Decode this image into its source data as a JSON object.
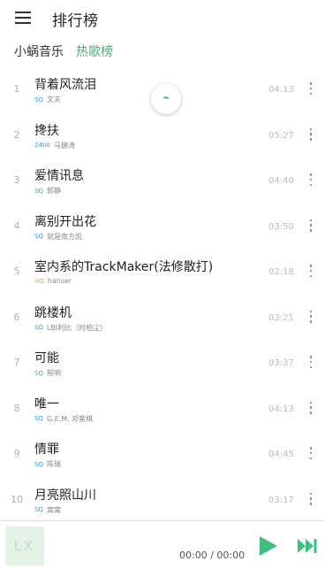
{
  "header": {
    "title": "排行榜",
    "menu_icon": "hamburger-menu-icon"
  },
  "breadcrumb": {
    "source": "小蜗音乐",
    "active": "热歌榜",
    "active_color": "#4caf7a"
  },
  "songs": [
    {
      "rank": "1",
      "title": "背着风流泪",
      "quality": "SQ",
      "artist": "文夫",
      "duration": "04:13"
    },
    {
      "rank": "2",
      "title": "搀扶",
      "quality": "24bit",
      "artist": "马健涛",
      "duration": "05:27"
    },
    {
      "rank": "3",
      "title": "爱情讯息",
      "quality": "SQ",
      "artist": "郭静",
      "duration": "04:40"
    },
    {
      "rank": "4",
      "title": "离别开出花",
      "quality": "SQ",
      "artist": "就是南方凯",
      "duration": "03:50"
    },
    {
      "rank": "5",
      "title": "室内系的TrackMaker(法修散打)",
      "quality": "HQ",
      "artist": "hanser",
      "duration": "02:18"
    },
    {
      "rank": "6",
      "title": "跳楼机",
      "quality": "SQ",
      "artist": "LBI利比（时柏尘）",
      "duration": "03:21"
    },
    {
      "rank": "7",
      "title": "可能",
      "quality": "SQ",
      "artist": "程响",
      "duration": "03:37"
    },
    {
      "rank": "8",
      "title": "唯一",
      "quality": "SQ",
      "artist": "G.E.M. 邓紫棋",
      "duration": "04:13"
    },
    {
      "rank": "9",
      "title": "情罪",
      "quality": "SQ",
      "artist": "陈瑞",
      "duration": "04:45"
    },
    {
      "rank": "10",
      "title": "月亮照山川",
      "quality": "SQ",
      "artist": "窝窝",
      "duration": "03:17"
    }
  ],
  "player": {
    "cover_text": "LX",
    "time": "00:00 / 00:00",
    "play_icon": "play-icon",
    "next_icon": "skip-next-icon",
    "accent": "#3fbf7f"
  }
}
